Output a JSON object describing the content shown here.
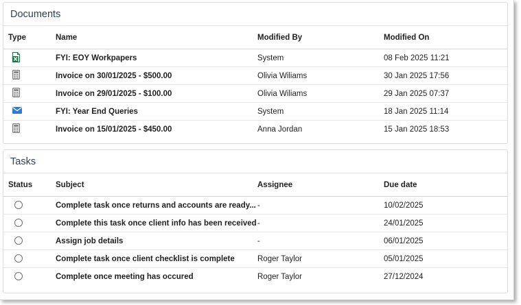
{
  "documents": {
    "title": "Documents",
    "columns": {
      "type": "Type",
      "name": "Name",
      "modified_by": "Modified By",
      "modified_on": "Modified On"
    },
    "rows": [
      {
        "icon": "excel-icon",
        "name": "FYI: EOY Workpapers",
        "modified_by": "System",
        "modified_on": "08 Feb 2025 11:21"
      },
      {
        "icon": "calculator-icon",
        "name": "Invoice on 30/01/2025 - $500.00",
        "modified_by": "Olivia Wiliams",
        "modified_on": "30 Jan 2025 17:56"
      },
      {
        "icon": "calculator-icon",
        "name": "Invoice on 29/01/2025 - $100.00",
        "modified_by": "Olivia Wiliams",
        "modified_on": "29 Jan 2025 07:37"
      },
      {
        "icon": "envelope-icon",
        "name": "FYI: Year End Queries",
        "modified_by": "System",
        "modified_on": "18 Jan 2025 11:14"
      },
      {
        "icon": "calculator-icon",
        "name": "Invoice on 15/01/2025 - $450.00",
        "modified_by": "Anna Jordan",
        "modified_on": "15 Jan 2025 18:53"
      }
    ]
  },
  "tasks": {
    "title": "Tasks",
    "columns": {
      "status": "Status",
      "subject": "Subject",
      "assignee": "Assignee",
      "due_date": "Due date"
    },
    "rows": [
      {
        "subject": "Complete task once returns and accounts are ready...",
        "assignee": "-",
        "due_date": "10/02/2025"
      },
      {
        "subject": "Complete this task once client info has been received",
        "assignee": "-",
        "due_date": "24/01/2025"
      },
      {
        "subject": "Assign job details",
        "assignee": "-",
        "due_date": "06/01/2025"
      },
      {
        "subject": "Complete task once client checklist is complete",
        "assignee": "Roger Taylor",
        "due_date": "05/01/2025"
      },
      {
        "subject": "Complete once meeting has occured",
        "assignee": "Roger Taylor",
        "due_date": "27/12/2024"
      }
    ]
  },
  "colors": {
    "excel": "#1e7145",
    "envelope": "#2e7bcf",
    "calculator": "#7a7a7a",
    "header_text": "#2d3f55"
  }
}
